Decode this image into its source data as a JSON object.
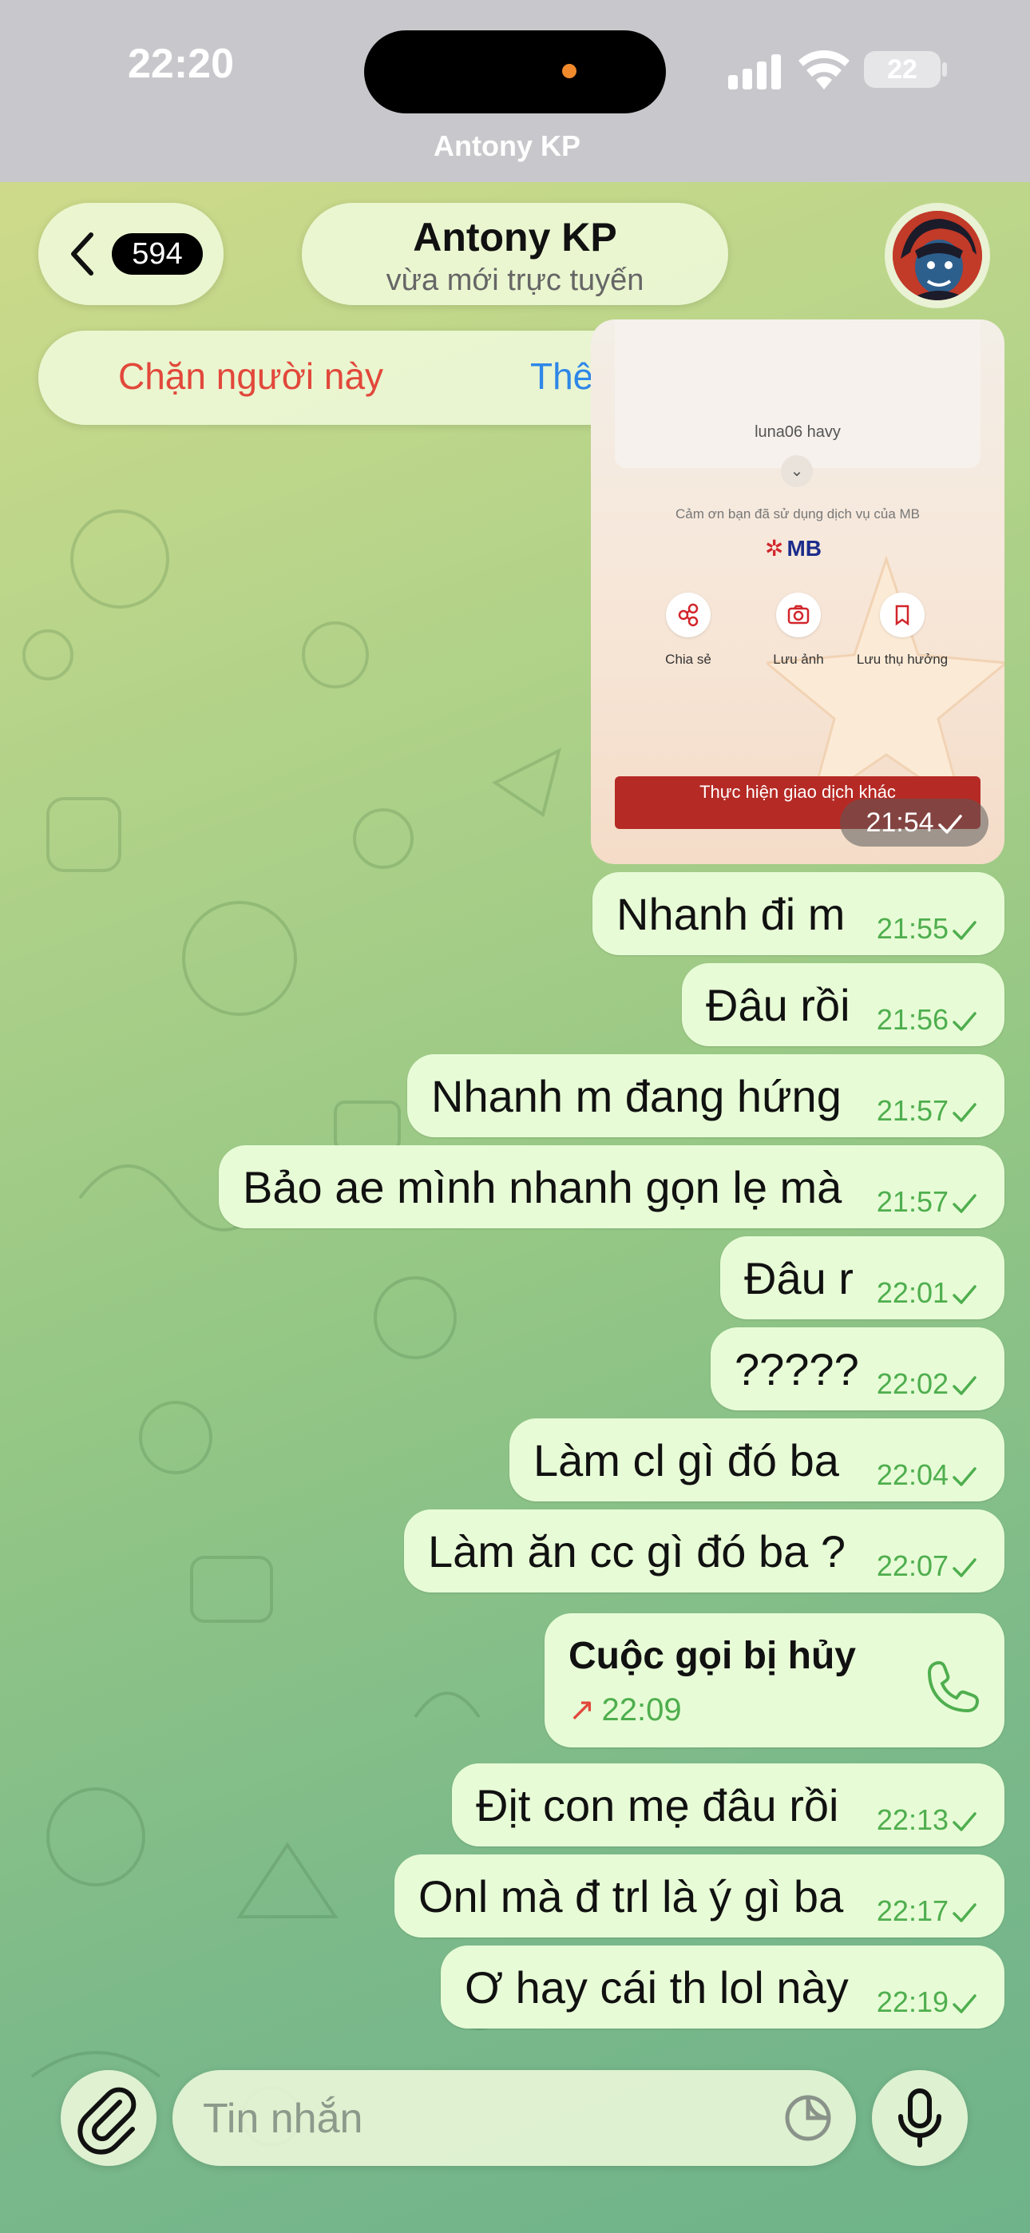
{
  "status_bar": {
    "time": "22:20",
    "battery": "22",
    "title": "Antony KP"
  },
  "header": {
    "back_count": "594",
    "contact_name": "Antony KP",
    "contact_status": "vừa mới trực tuyến"
  },
  "action_bar": {
    "block_label": "Chặn người này",
    "add_label": "Thêm vào danh bạ"
  },
  "receipt": {
    "field_value": "luna06 havy",
    "thanks": "Cảm ơn bạn đã sử dụng dịch vụ của MB",
    "bank": "MB",
    "actions": [
      "Chia sẻ",
      "Lưu ảnh",
      "Lưu thụ hưởng"
    ],
    "button": "Thực hiện giao dịch khác",
    "time": "21:54"
  },
  "messages": [
    {
      "text": "Nhanh đi m",
      "time": "21:55"
    },
    {
      "text": "Đâu rồi",
      "time": "21:56"
    },
    {
      "text": "Nhanh m đang hứng",
      "time": "21:57"
    },
    {
      "text": "Bảo ae mình nhanh gọn lẹ mà",
      "time": "21:57"
    },
    {
      "text": "Đâu r",
      "time": "22:01"
    },
    {
      "text": "?????",
      "time": "22:02"
    },
    {
      "text": "Làm cl gì đó ba",
      "time": "22:04"
    },
    {
      "text": "Làm ăn cc gì đó ba ?",
      "time": "22:07"
    },
    {
      "text": "Địt con mẹ đâu rồi",
      "time": "22:13"
    },
    {
      "text": "Onl mà đ trl là ý gì ba",
      "time": "22:17"
    },
    {
      "text": "Ơ hay cái th lol này",
      "time": "22:19"
    }
  ],
  "call": {
    "title": "Cuộc gọi bị hủy",
    "time": "22:09"
  },
  "composer": {
    "placeholder": "Tin nhắn"
  },
  "colors": {
    "bubble": "#e7fcd6",
    "time_green": "#4fae4e",
    "block_red": "#e2483b",
    "add_blue": "#2e87e8"
  }
}
